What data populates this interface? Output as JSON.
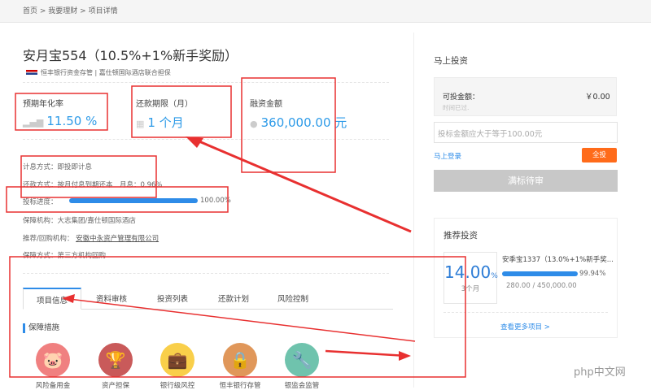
{
  "breadcrumb": [
    "首页",
    "我要理财",
    "项目详情"
  ],
  "breadcrumb_sep": " > ",
  "product": {
    "title": "安月宝554（10.5%+1%新手奖励）",
    "subtitle": "恒丰银行资金存管 | 嘉仕顿国际酒店联合担保"
  },
  "stats": [
    {
      "label": "预期年化率",
      "value": "11.50 %",
      "icon": "signal-icon"
    },
    {
      "label": "还款期限（月）",
      "value": "1 个月",
      "icon": "calendar-icon"
    },
    {
      "label": "融资金额",
      "value": "360,000.00 元",
      "icon": "money-bag-icon"
    }
  ],
  "info": {
    "interest": "计息方式：即投即计息",
    "repay": "还款方式：按月付息到期还本　月息：0.96%",
    "progress_label": "投标进度：",
    "progress_value": "100.00%",
    "progress": 100,
    "guarantor": "保障机构：大志集团/嘉仕顿国际酒店",
    "recommend_label": "推荐/回购机构：",
    "recommend_link": "安徽中永资产管理有限公司",
    "guarantee_method": "保障方式：第三方机构回购"
  },
  "tabs": [
    "项目信息",
    "资料审核",
    "投资列表",
    "还款计划",
    "风险控制"
  ],
  "section_title": "保障措施",
  "guarantees": [
    {
      "label": "风险备用金",
      "icon": "piggy-bank-icon",
      "color": "#f08080"
    },
    {
      "label": "资产担保",
      "icon": "trophy-icon",
      "color": "#c95a5a"
    },
    {
      "label": "银行级风控",
      "icon": "briefcase-icon",
      "color": "#f9cf4a"
    },
    {
      "label": "恒丰银行存管",
      "icon": "lock-icon",
      "color": "#e0975a"
    },
    {
      "label": "银监会监管",
      "icon": "tools-icon",
      "color": "#6fc3ad"
    }
  ],
  "invest": {
    "title": "马上投资",
    "available_label": "可投金额：",
    "available_value": "￥0.00",
    "time_note": "时间已过.",
    "amount_placeholder": "投标金额应大于等于100.00元",
    "login_link": "马上登录",
    "all_in": "全投",
    "status_button": "满标待审"
  },
  "recommend": {
    "title": "推荐投资",
    "rate": "14.00",
    "rate_unit": "%",
    "term": "3个月",
    "name": "安季宝1337（13.0%+1%新手奖...",
    "progress": 99.94,
    "progress_value": "99.94%",
    "amounts": "280.00 / 450,000.00",
    "more": "查看更多项目 >"
  },
  "watermark": "php中文网"
}
